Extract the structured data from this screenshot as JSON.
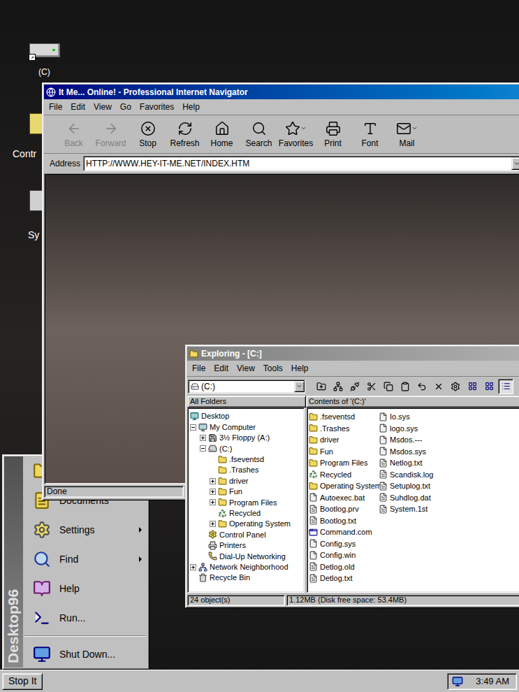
{
  "desktop_icons": [
    {
      "label": "(C)"
    },
    {
      "label": "Contr"
    },
    {
      "label": "Sy"
    }
  ],
  "browser": {
    "title": "It Me... Online! - Professional Internet Navigator",
    "menu": [
      "File",
      "Edit",
      "View",
      "Go",
      "Favorites",
      "Help"
    ],
    "toolbar": [
      {
        "label": "Back",
        "disabled": true,
        "dropdown": false
      },
      {
        "label": "Forward",
        "disabled": true,
        "dropdown": false
      },
      {
        "label": "Stop",
        "disabled": false,
        "dropdown": false
      },
      {
        "label": "Refresh",
        "disabled": false,
        "dropdown": false
      },
      {
        "label": "Home",
        "disabled": false,
        "dropdown": false
      },
      {
        "label": "Search",
        "disabled": false,
        "dropdown": false
      },
      {
        "label": "Favorites",
        "disabled": false,
        "dropdown": true
      },
      {
        "label": "Print",
        "disabled": false,
        "dropdown": false
      },
      {
        "label": "Font",
        "disabled": false,
        "dropdown": false
      },
      {
        "label": "Mail",
        "disabled": false,
        "dropdown": true
      }
    ],
    "address_label": "Address",
    "address": "HTTP://WWW.HEY-IT-ME.NET/INDEX.HTM",
    "status": "Done"
  },
  "explorer": {
    "title": "Exploring - [C:]",
    "menu": [
      "File",
      "Edit",
      "View",
      "Tools",
      "Help"
    ],
    "drive": "(C:)",
    "view_buttons": [
      {
        "selected": false
      },
      {
        "selected": false
      },
      {
        "selected": true
      },
      {
        "selected": false
      }
    ],
    "tree_header": "All Folders",
    "contents_header": "Contents of '(C:)'",
    "tree": [
      {
        "label": "Desktop",
        "depth": 0,
        "kind": "desktop",
        "has_children": false,
        "expanded": false
      },
      {
        "label": "My Computer",
        "depth": 1,
        "kind": "computer",
        "has_children": true,
        "expanded": true
      },
      {
        "label": "3½ Floppy (A:)",
        "depth": 2,
        "kind": "floppy",
        "has_children": true,
        "expanded": false
      },
      {
        "label": "(C:)",
        "depth": 2,
        "kind": "drive",
        "has_children": true,
        "expanded": true
      },
      {
        "label": ".fseventsd",
        "depth": 3,
        "kind": "folder",
        "has_children": false,
        "expanded": false
      },
      {
        "label": ".Trashes",
        "depth": 3,
        "kind": "folder",
        "has_children": false,
        "expanded": false
      },
      {
        "label": "driver",
        "depth": 3,
        "kind": "folder",
        "has_children": true,
        "expanded": false
      },
      {
        "label": "Fun",
        "depth": 3,
        "kind": "folder",
        "has_children": true,
        "expanded": false
      },
      {
        "label": "Program Files",
        "depth": 3,
        "kind": "folder",
        "has_children": true,
        "expanded": false
      },
      {
        "label": "Recycled",
        "depth": 3,
        "kind": "recycle",
        "has_children": false,
        "expanded": false
      },
      {
        "label": "Operating System",
        "depth": 3,
        "kind": "folder",
        "has_children": true,
        "expanded": false
      },
      {
        "label": "Control Panel",
        "depth": 2,
        "kind": "control",
        "has_children": false,
        "expanded": false
      },
      {
        "label": "Printers",
        "depth": 2,
        "kind": "printers",
        "has_children": false,
        "expanded": false
      },
      {
        "label": "Dial-Up Networking",
        "depth": 2,
        "kind": "dialup",
        "has_children": false,
        "expanded": false
      },
      {
        "label": "Network Neighborhood",
        "depth": 1,
        "kind": "network",
        "has_children": true,
        "expanded": false
      },
      {
        "label": "Recycle Bin",
        "depth": 1,
        "kind": "recyclebin",
        "has_children": false,
        "expanded": false
      }
    ],
    "files": [
      {
        "name": ".fseventsd",
        "kind": "folder"
      },
      {
        "name": ".Trashes",
        "kind": "folder"
      },
      {
        "name": "driver",
        "kind": "folder"
      },
      {
        "name": "Fun",
        "kind": "folder"
      },
      {
        "name": "Program Files",
        "kind": "folder"
      },
      {
        "name": "Recycled",
        "kind": "recycle"
      },
      {
        "name": "Operating System",
        "kind": "folder"
      },
      {
        "name": "Autoexec.bat",
        "kind": "sys"
      },
      {
        "name": "Bootlog.prv",
        "kind": "file"
      },
      {
        "name": "Bootlog.txt",
        "kind": "file"
      },
      {
        "name": "Command.com",
        "kind": "app"
      },
      {
        "name": "Config.sys",
        "kind": "sys"
      },
      {
        "name": "Config.win",
        "kind": "sys"
      },
      {
        "name": "Detlog.old",
        "kind": "file"
      },
      {
        "name": "Detlog.txt",
        "kind": "file"
      },
      {
        "name": "Io.sys",
        "kind": "sys"
      },
      {
        "name": "logo.sys",
        "kind": "sys"
      },
      {
        "name": "Msdos.---",
        "kind": "sys"
      },
      {
        "name": "Msdos.sys",
        "kind": "sys"
      },
      {
        "name": "Netlog.txt",
        "kind": "file"
      },
      {
        "name": "Scandisk.log",
        "kind": "file"
      },
      {
        "name": "Setuplog.txt",
        "kind": "file"
      },
      {
        "name": "Suhdlog.dat",
        "kind": "file"
      },
      {
        "name": "System.1st",
        "kind": "file"
      }
    ],
    "status_objects": "24 object(s)",
    "status_size": "1.12MB (Disk free space: 53.4MB)"
  },
  "start_menu": {
    "brand": "Desktop96",
    "items": [
      {
        "label": "Documents",
        "submenu": false
      },
      {
        "label": "Settings",
        "submenu": true
      },
      {
        "label": "Find",
        "submenu": true
      },
      {
        "label": "Help",
        "submenu": false
      },
      {
        "label": "Run...",
        "submenu": false
      },
      {
        "label": "Shut Down...",
        "submenu": false
      }
    ]
  },
  "taskbar": {
    "start": "Stop It",
    "clock": "3:49 AM"
  }
}
